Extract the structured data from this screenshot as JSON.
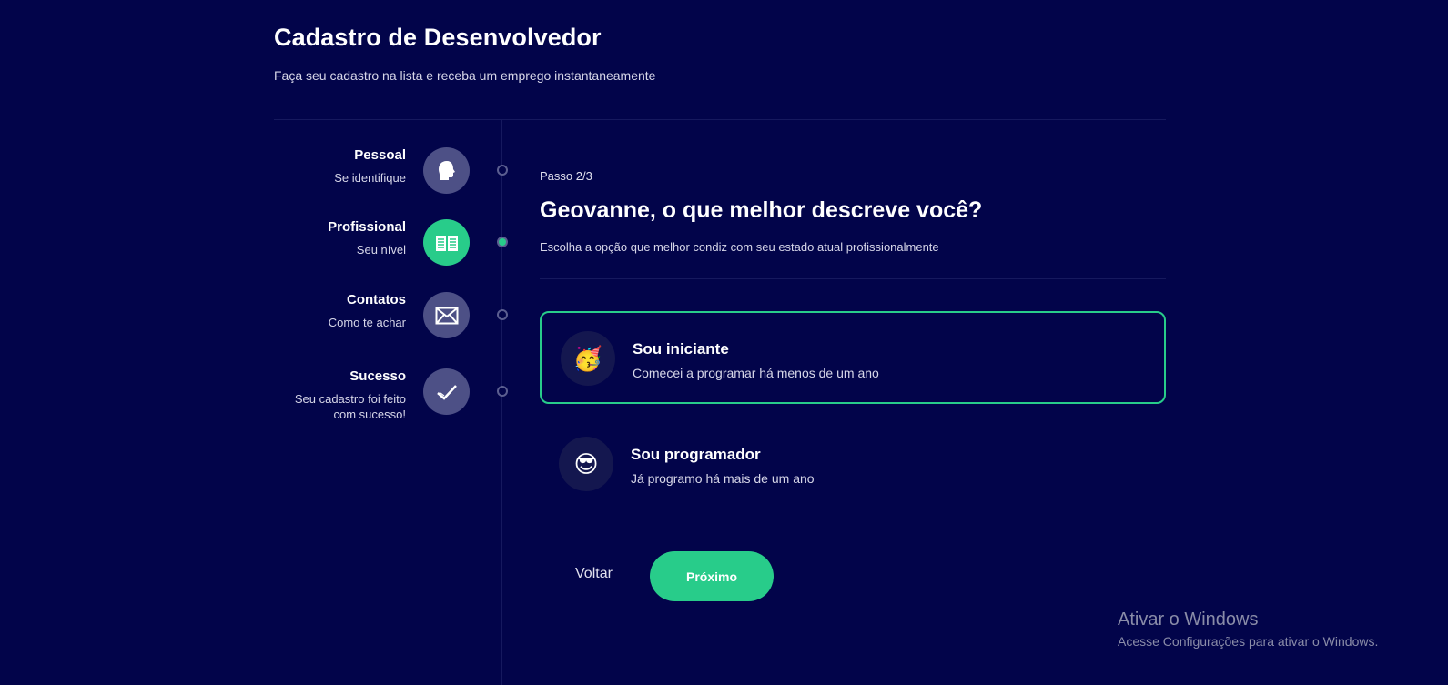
{
  "header": {
    "title": "Cadastro de Desenvolvedor",
    "subtitle": "Faça seu cadastro na lista e receba um emprego instantaneamente"
  },
  "steps": [
    {
      "title": "Pessoal",
      "description": "Se identifique",
      "icon": "head-icon",
      "active": false
    },
    {
      "title": "Profissional",
      "description": "Seu nível",
      "icon": "book-icon",
      "active": true
    },
    {
      "title": "Contatos",
      "description": "Como te achar",
      "icon": "mail-icon",
      "active": false
    },
    {
      "title": "Sucesso",
      "description": "Seu cadastro foi feito com sucesso!",
      "icon": "check-icon",
      "active": false
    }
  ],
  "main": {
    "step_counter": "Passo 2/3",
    "question": "Geovanne, o que melhor descreve você?",
    "description": "Escolha a opção que melhor condiz com seu estado atual profissionalmente"
  },
  "options": [
    {
      "emoji": "🥳",
      "title": "Sou iniciante",
      "description": "Comecei a programar há menos de um ano",
      "selected": true
    },
    {
      "emoji": "😎",
      "title": "Sou programador",
      "description": "Já programo há mais de um ano",
      "selected": false
    }
  ],
  "actions": {
    "back_label": "Voltar",
    "next_label": "Próximo"
  },
  "watermark": {
    "title": "Ativar o Windows",
    "subtitle": "Acesse Configurações para ativar o Windows."
  },
  "colors": {
    "background": "#02044a",
    "accent": "#28cc8a",
    "inactive_circle": "#4d5086"
  }
}
